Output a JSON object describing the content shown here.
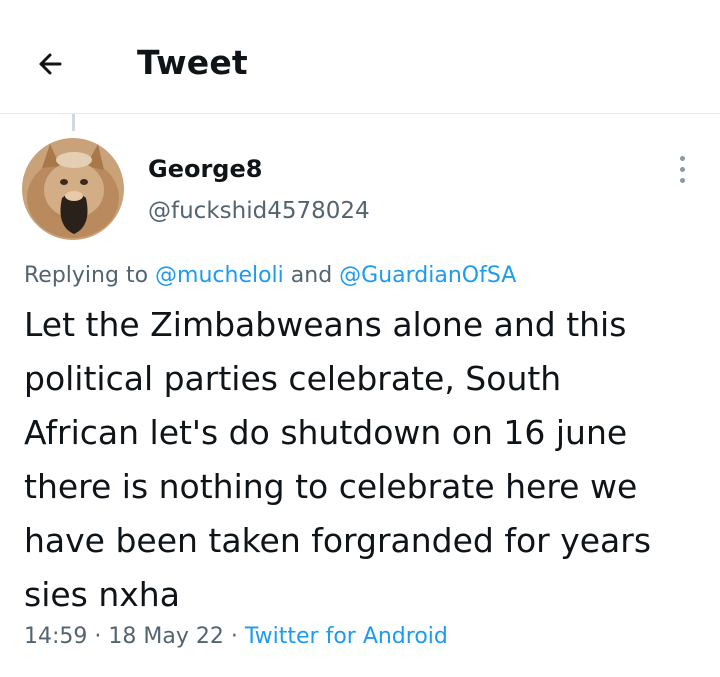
{
  "header": {
    "back_icon": "arrow-left-icon",
    "title": "Tweet"
  },
  "tweet": {
    "author": {
      "display_name": "George8",
      "handle": "@fuckshid4578024",
      "avatar_icon": "cat-profile-avatar"
    },
    "more_icon": "vertical-ellipsis-icon",
    "replying": {
      "prefix": "Replying to ",
      "user1": "@mucheloli",
      "conjunction": " and ",
      "user2": "@GuardianOfSA"
    },
    "text": "Let the Zimbabweans alone and this\npolitical parties celebrate, South\nAfrican let's do shutdown on 16 june\nthere is nothing to celebrate here we\nhave been taken forgranded for years\nsies nxha",
    "meta": {
      "time": "14:59",
      "separator1": " · ",
      "date": "18 May 22",
      "separator2": " · ",
      "source": "Twitter for Android"
    }
  },
  "colors": {
    "text_primary": "#0f1419",
    "text_secondary": "#536471",
    "link": "#1d9bf0",
    "divider": "#e6e9eb"
  }
}
